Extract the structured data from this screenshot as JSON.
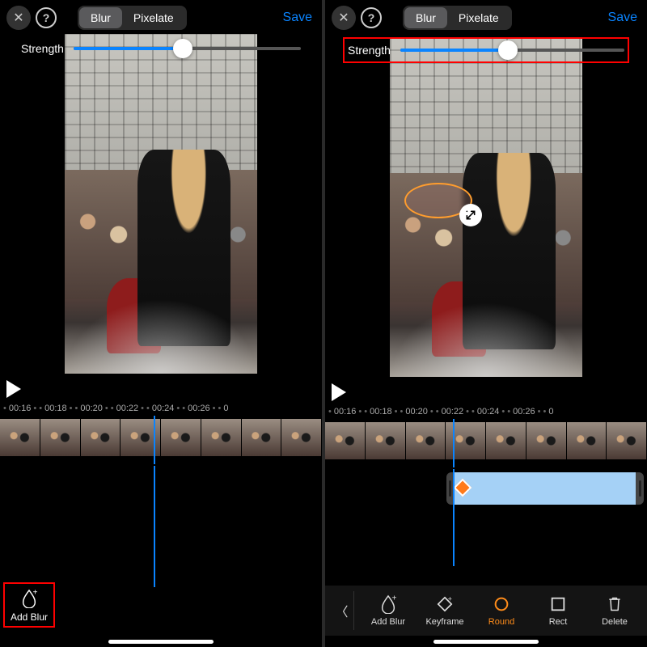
{
  "topbar": {
    "tabs": {
      "blur": "Blur",
      "pixelate": "Pixelate"
    },
    "save": "Save",
    "close_glyph": "✕",
    "help_glyph": "?"
  },
  "strength": {
    "label": "Strength",
    "value_pct": 48
  },
  "timeline": {
    "ticks": [
      "00:16",
      "00:18",
      "00:20",
      "00:22",
      "00:24",
      "00:26",
      "0"
    ]
  },
  "bottom": {
    "add_blur": "Add Blur"
  },
  "toolbar": {
    "back_glyph": "〈",
    "items": [
      {
        "key": "add-blur",
        "label": "Add Blur"
      },
      {
        "key": "keyframe",
        "label": "Keyframe"
      },
      {
        "key": "round",
        "label": "Round",
        "active": true
      },
      {
        "key": "rect",
        "label": "Rect"
      },
      {
        "key": "delete",
        "label": "Delete"
      }
    ]
  }
}
